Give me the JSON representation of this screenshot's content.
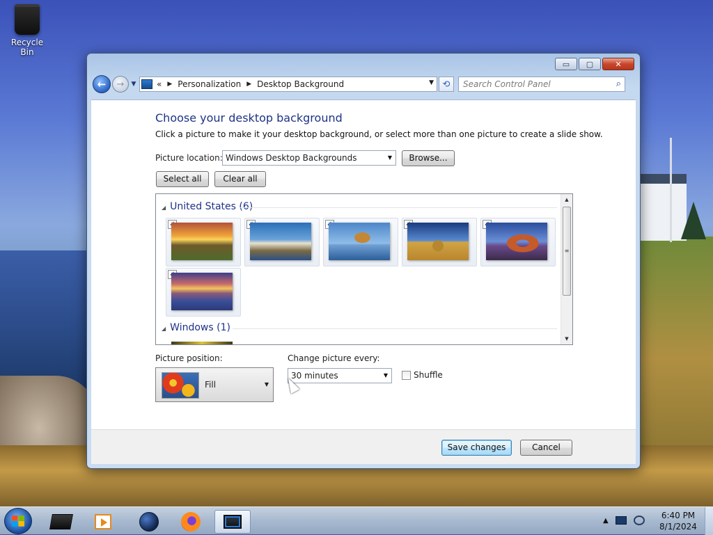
{
  "desktop": {
    "icons": [
      {
        "label": "Recycle Bin",
        "icon": "recycle-bin-icon"
      }
    ]
  },
  "window": {
    "controls": {
      "minimize": "▭",
      "maximize": "▢",
      "close": "✕"
    }
  },
  "navbar": {
    "breadcrumb_prefix": "«",
    "breadcrumb": [
      "Personalization",
      "Desktop Background"
    ],
    "search_placeholder": "Search Control Panel"
  },
  "main": {
    "heading": "Choose your desktop background",
    "subtitle": "Click a picture to make it your desktop background, or select more than one picture to create a slide show.",
    "picture_location_label": "Picture location:",
    "picture_location_value": "Windows Desktop Backgrounds",
    "browse_label": "Browse...",
    "select_all_label": "Select all",
    "clear_all_label": "Clear all",
    "groups": [
      {
        "title": "United States (6)",
        "thumbnails": [
          {
            "name": "sunset-field",
            "checked": true
          },
          {
            "name": "lighthouse",
            "checked": true
          },
          {
            "name": "beach-rock",
            "checked": true
          },
          {
            "name": "hay-bale",
            "checked": true
          },
          {
            "name": "delicate-arch",
            "checked": true
          },
          {
            "name": "lake-flowers",
            "checked": true
          }
        ]
      },
      {
        "title": "Windows (1)"
      }
    ],
    "picture_position_label": "Picture position:",
    "picture_position_value": "Fill",
    "change_picture_label": "Change picture every:",
    "change_picture_value": "30 minutes",
    "shuffle_label": "Shuffle",
    "shuffle_checked": false
  },
  "footer": {
    "save_label": "Save changes",
    "cancel_label": "Cancel"
  },
  "taskbar": {
    "apps": [
      "file-explorer",
      "media-player",
      "globe-app",
      "firefox",
      "control-panel"
    ],
    "active_app": "control-panel",
    "clock_time": "6:40 PM",
    "clock_date": "8/1/2024"
  },
  "colors": {
    "heading": "#1e3287",
    "title_bar": "#a9c4e6",
    "close_button": "#c8462c"
  }
}
